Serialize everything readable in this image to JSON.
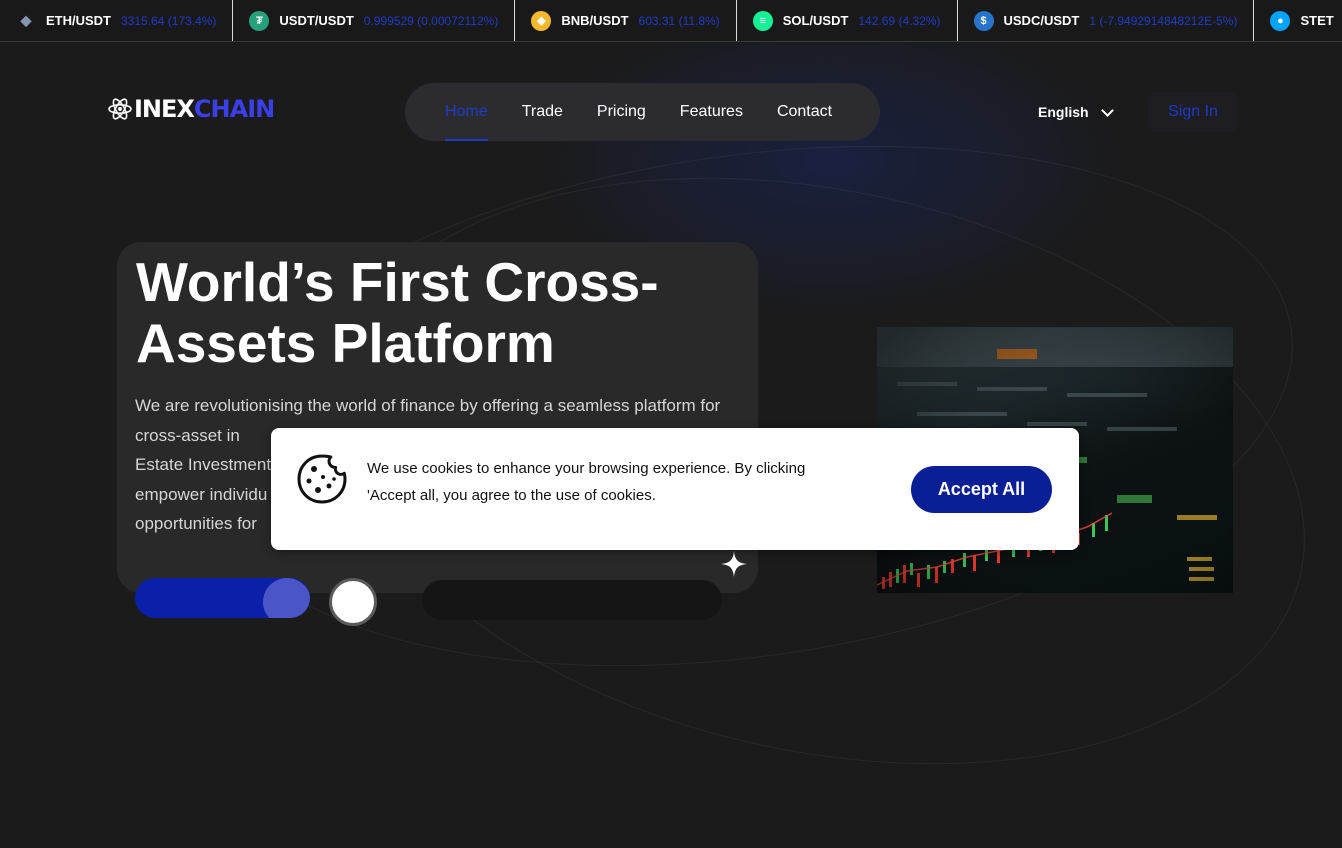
{
  "ticker": [
    {
      "pair": "ETH/USDT",
      "value": "3315.64 (173.4%)",
      "icon": "ethereum-icon",
      "icon_color": "#8a92b2"
    },
    {
      "pair": "USDT/USDT",
      "value": "0.999529 (0.00072112%)",
      "icon": "tether-icon",
      "icon_color": "#26a17b"
    },
    {
      "pair": "BNB/USDT",
      "value": "603.31 (11.8%)",
      "icon": "bnb-icon",
      "icon_color": "#f3ba2f"
    },
    {
      "pair": "SOL/USDT",
      "value": "142.69 (4.32%)",
      "icon": "solana-icon",
      "icon_color": "#14f195"
    },
    {
      "pair": "USDC/USDT",
      "value": "1 (-7.9492914848212E-5%)",
      "icon": "usdc-icon",
      "icon_color": "#2775ca"
    },
    {
      "pair": "STET",
      "value": "",
      "icon": "steth-icon",
      "icon_color": "#00a3ff"
    }
  ],
  "brand": {
    "logo_white": "INEX",
    "logo_blue": "CHAIN"
  },
  "nav": {
    "items": [
      {
        "label": "Home",
        "active": true
      },
      {
        "label": "Trade"
      },
      {
        "label": "Pricing"
      },
      {
        "label": "Features"
      },
      {
        "label": "Contact"
      }
    ]
  },
  "header": {
    "language": "English",
    "signin": "Sign In"
  },
  "hero": {
    "title": "World’s First Cross-Assets Platform",
    "description": "We are revolutionising the world of finance by offering a seamless platform for cross-asset in",
    "desc_line3": "Estate Investment",
    "desc_line4": "empower individu",
    "desc_line5": "opportunities for"
  },
  "cookie": {
    "message": "We use cookies to enhance your browsing experience. By clicking 'Accept all, you agree to the use of cookies.",
    "accept_label": "Accept All",
    "icon": "cookie-icon"
  },
  "colors": {
    "accent": "#1f3cc6",
    "button": "#0a1f96",
    "background": "#1c1b1c",
    "logo_blue": "#3b3fe8"
  }
}
